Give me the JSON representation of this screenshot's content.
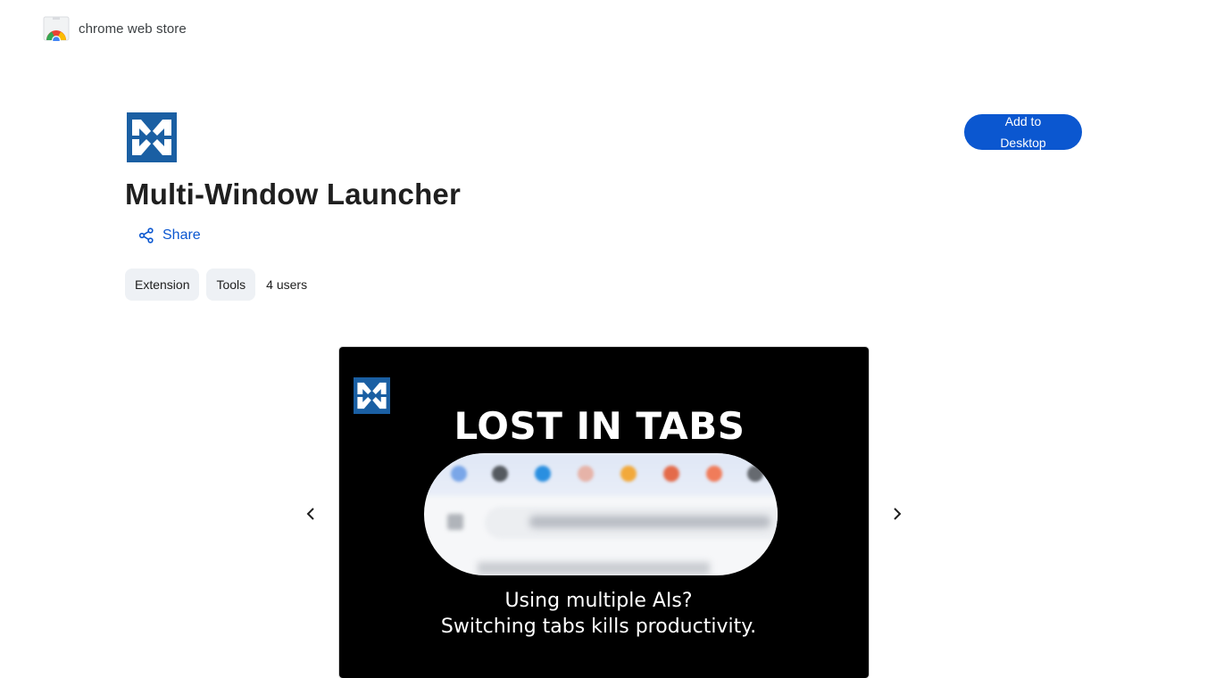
{
  "header": {
    "store_name": "chrome web store",
    "logo_icon": "chrome-web-store-icon"
  },
  "extension": {
    "icon": "multi-window-launcher-logo",
    "title": "Multi-Window Launcher",
    "share_label": "Share",
    "chips": [
      "Extension",
      "Tools"
    ],
    "users": "4 users",
    "add_button_label": "Add to Desktop",
    "accent_color": "#0b57d0"
  },
  "carousel": {
    "prev_icon": "chevron-left-icon",
    "next_icon": "chevron-right-icon",
    "slide": {
      "headline": "LOST IN TABS",
      "caption_line1": "Using multiple AIs?",
      "caption_line2": "Switching tabs kills productivity.",
      "background": "#000000"
    }
  }
}
